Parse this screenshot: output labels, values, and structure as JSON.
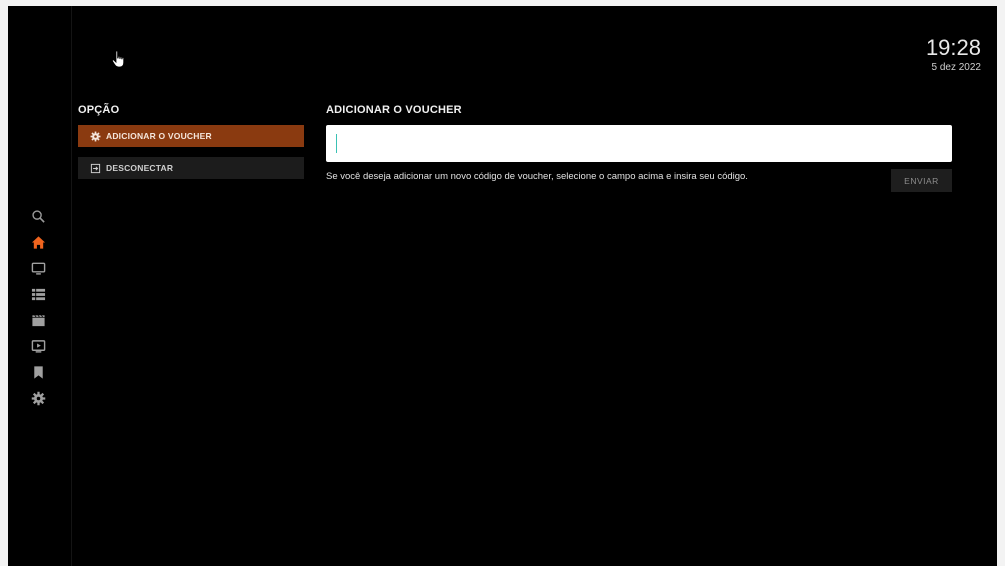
{
  "clock": {
    "time": "19:28",
    "date": "5 dez 2022"
  },
  "nav": {
    "items": [
      {
        "icon": "search-icon",
        "active": false
      },
      {
        "icon": "home-icon",
        "active": true
      },
      {
        "icon": "tv-icon",
        "active": false
      },
      {
        "icon": "list-icon",
        "active": false
      },
      {
        "icon": "movie-icon",
        "active": false
      },
      {
        "icon": "play-screen-icon",
        "active": false
      },
      {
        "icon": "bookmark-icon",
        "active": false
      },
      {
        "icon": "settings-icon",
        "active": false
      }
    ]
  },
  "options": {
    "heading": "OPÇÃO",
    "add_voucher_label": "ADICIONAR O VOUCHER",
    "disconnect_label": "DESCONECTAR"
  },
  "voucher": {
    "heading": "ADICIONAR O VOUCHER",
    "input_value": "",
    "help_text": "Se você deseja adicionar um novo código de voucher, selecione o campo acima e insira seu código.",
    "send_label": "ENVIAR"
  },
  "colors": {
    "accent": "#f0641e",
    "selected": "#8a3a10",
    "background": "#000000"
  }
}
